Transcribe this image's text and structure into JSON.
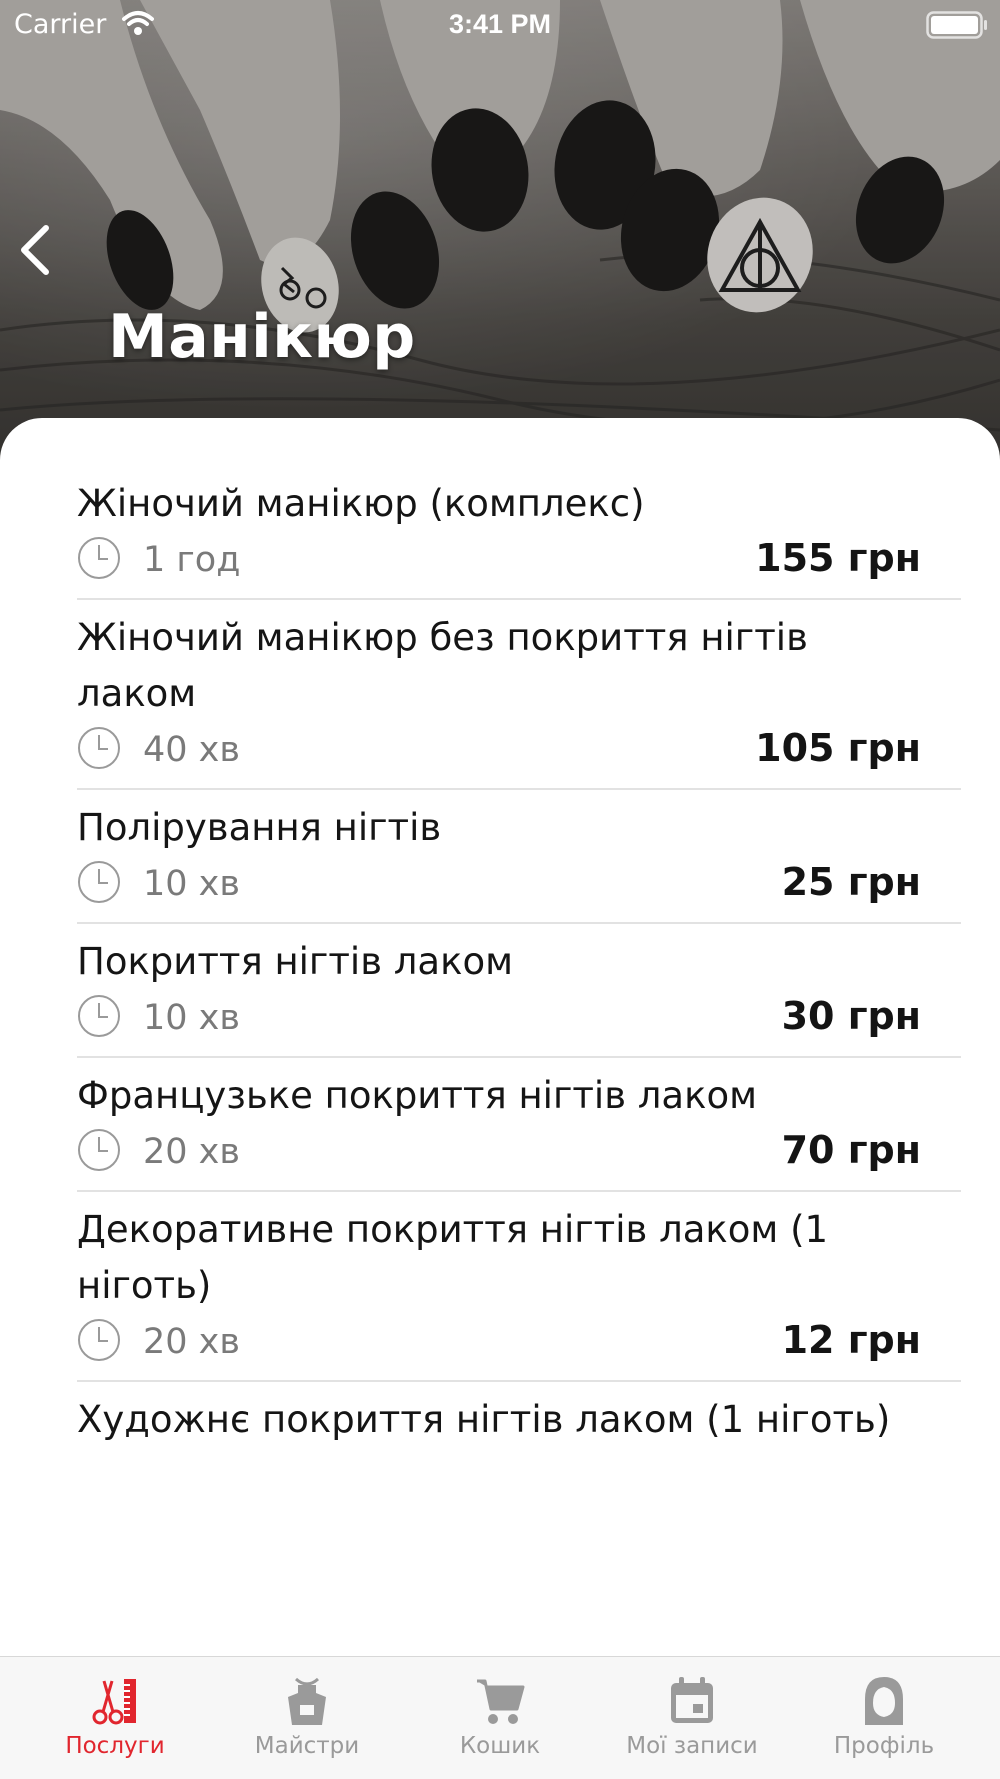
{
  "status_bar": {
    "carrier": "Carrier",
    "time": "3:41 PM"
  },
  "header": {
    "title": "Манікюр"
  },
  "services": [
    {
      "name": "Жіночий манікюр (комплекс)",
      "duration": "1 год",
      "price": "155 грн"
    },
    {
      "name": "Жіночий манікюр без покриття нігтів лаком",
      "duration": "40 хв",
      "price": "105 грн"
    },
    {
      "name": "Полірування нігтів",
      "duration": "10 хв",
      "price": "25 грн"
    },
    {
      "name": "Покриття нігтів лаком",
      "duration": "10 хв",
      "price": "30 грн"
    },
    {
      "name": "Французьке покриття нігтів лаком",
      "duration": "20 хв",
      "price": "70 грн"
    },
    {
      "name": "Декоративне покриття нігтів лаком (1 ніготь)",
      "duration": "20 хв",
      "price": "12 грн"
    },
    {
      "name": "Художнє покриття нігтів лаком (1 ніготь)",
      "duration": "",
      "price": ""
    }
  ],
  "tabbar": {
    "tabs": [
      {
        "label": "Послуги",
        "icon": "scissors-comb-icon",
        "active": true
      },
      {
        "label": "Майстри",
        "icon": "apron-icon",
        "active": false
      },
      {
        "label": "Кошик",
        "icon": "cart-icon",
        "active": false
      },
      {
        "label": "Мої записи",
        "icon": "calendar-icon",
        "active": false
      },
      {
        "label": "Профіль",
        "icon": "profile-icon",
        "active": false
      }
    ]
  },
  "colors": {
    "accent": "#e1262e",
    "inactive": "#9a9a9a",
    "divider": "#e2e2e2"
  }
}
